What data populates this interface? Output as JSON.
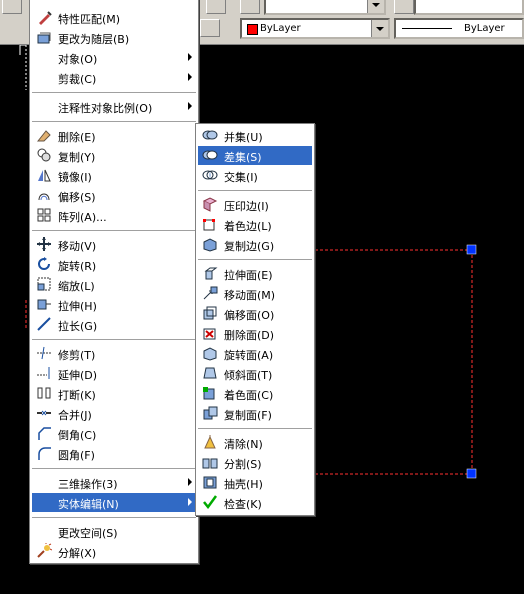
{
  "toolbar": {
    "color_combo": "ByLayer",
    "linetype_combo": "ByLayer",
    "color_accent": "#ff0000"
  },
  "main_menu": {
    "items": [
      {
        "label": "特性匹配(M)",
        "icon": "match-properties-icon"
      },
      {
        "label": "更改为随层(B)",
        "icon": "change-to-bylayer-icon"
      },
      {
        "label": "对象(O)",
        "submenu": true
      },
      {
        "label": "剪裁(C)",
        "submenu": true
      },
      {
        "label": "注释性对象比例(O)",
        "submenu": true
      },
      {
        "label": "删除(E)",
        "icon": "erase-icon"
      },
      {
        "label": "复制(Y)",
        "icon": "copy-icon"
      },
      {
        "label": "镜像(I)",
        "icon": "mirror-icon"
      },
      {
        "label": "偏移(S)",
        "icon": "offset-icon"
      },
      {
        "label": "阵列(A)...",
        "icon": "array-icon"
      },
      {
        "label": "移动(V)",
        "icon": "move-icon"
      },
      {
        "label": "旋转(R)",
        "icon": "rotate-icon"
      },
      {
        "label": "缩放(L)",
        "icon": "scale-icon"
      },
      {
        "label": "拉伸(H)",
        "icon": "stretch-icon"
      },
      {
        "label": "拉长(G)",
        "icon": "lengthen-icon"
      },
      {
        "label": "修剪(T)",
        "icon": "trim-icon"
      },
      {
        "label": "延伸(D)",
        "icon": "extend-icon"
      },
      {
        "label": "打断(K)",
        "icon": "break-icon"
      },
      {
        "label": "合并(J)",
        "icon": "join-icon"
      },
      {
        "label": "倒角(C)",
        "icon": "chamfer-icon"
      },
      {
        "label": "圆角(F)",
        "icon": "fillet-icon"
      },
      {
        "label": "三维操作(3)",
        "submenu": true
      },
      {
        "label": "实体编辑(N)",
        "submenu": true,
        "highlighted": true
      },
      {
        "label": "更改空间(S)"
      },
      {
        "label": "分解(X)",
        "icon": "explode-icon"
      }
    ]
  },
  "submenu": {
    "items": [
      {
        "label": "并集(U)",
        "icon": "union-icon"
      },
      {
        "label": "差集(S)",
        "icon": "subtract-icon",
        "highlighted": true
      },
      {
        "label": "交集(I)",
        "icon": "intersect-icon"
      },
      {
        "label": "压印边(I)",
        "icon": "imprint-icon"
      },
      {
        "label": "着色边(L)",
        "icon": "color-edges-icon"
      },
      {
        "label": "复制边(G)",
        "icon": "copy-edges-icon"
      },
      {
        "label": "拉伸面(E)",
        "icon": "extrude-faces-icon"
      },
      {
        "label": "移动面(M)",
        "icon": "move-faces-icon"
      },
      {
        "label": "偏移面(O)",
        "icon": "offset-faces-icon"
      },
      {
        "label": "删除面(D)",
        "icon": "delete-faces-icon"
      },
      {
        "label": "旋转面(A)",
        "icon": "rotate-faces-icon"
      },
      {
        "label": "倾斜面(T)",
        "icon": "taper-faces-icon"
      },
      {
        "label": "着色面(C)",
        "icon": "color-faces-icon"
      },
      {
        "label": "复制面(F)",
        "icon": "copy-faces-icon"
      },
      {
        "label": "清除(N)",
        "icon": "clean-icon"
      },
      {
        "label": "分割(S)",
        "icon": "separate-icon"
      },
      {
        "label": "抽壳(H)",
        "icon": "shell-icon"
      },
      {
        "label": "检查(K)",
        "icon": "check-icon"
      }
    ]
  }
}
